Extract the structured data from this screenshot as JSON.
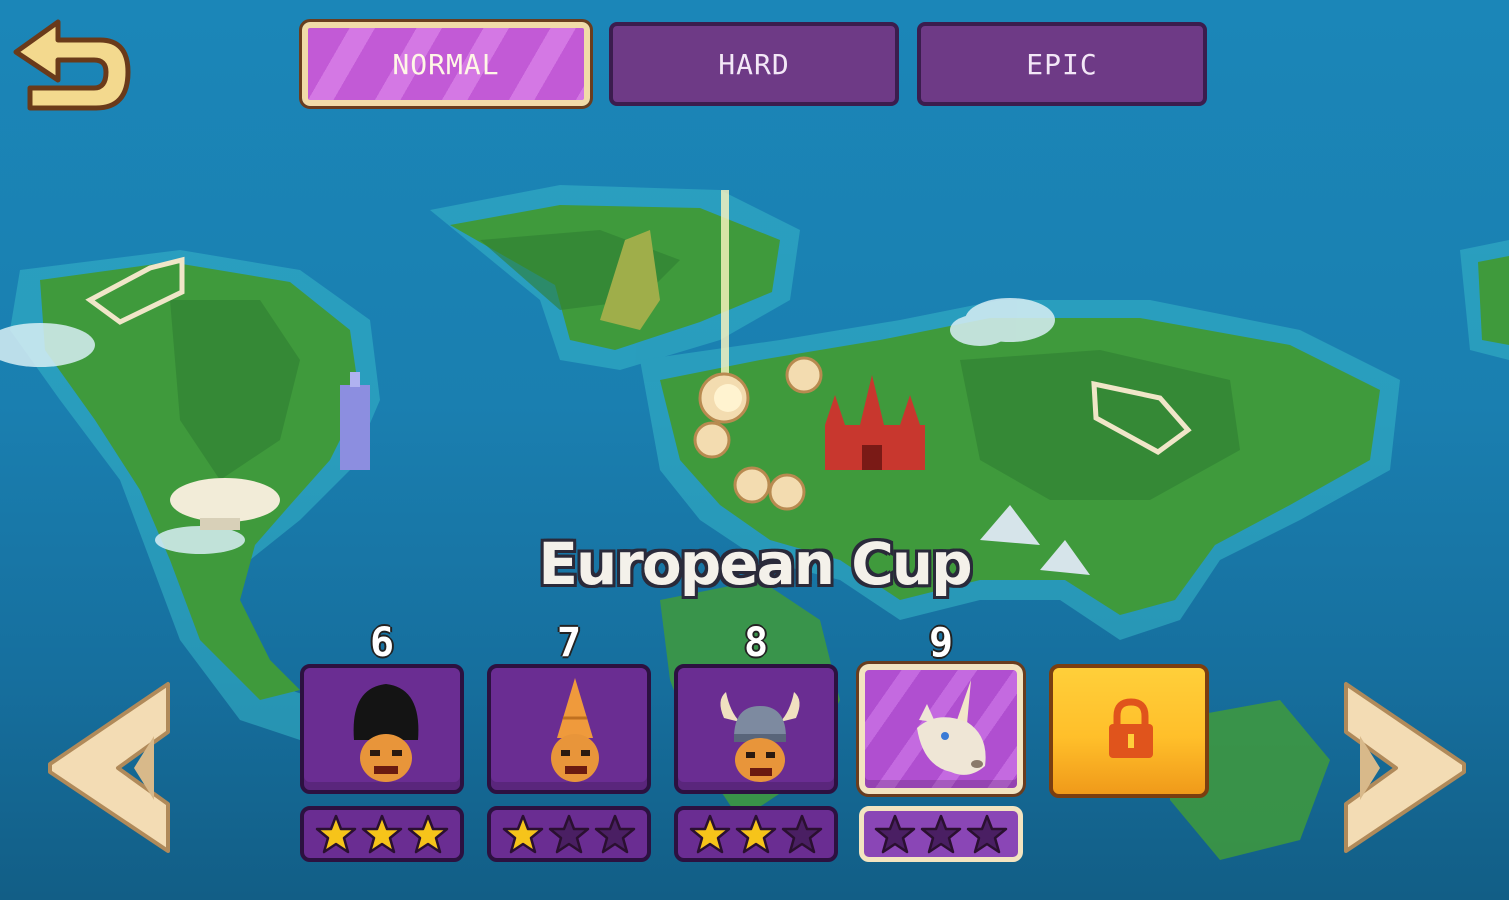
{
  "header": {
    "back_icon": "back-arrow-icon",
    "tabs": [
      {
        "label": "NORMAL",
        "active": true
      },
      {
        "label": "HARD",
        "active": false
      },
      {
        "label": "EPIC",
        "active": false
      }
    ]
  },
  "cup": {
    "title": "European Cup"
  },
  "levels": [
    {
      "number": "6",
      "stars_earned": 3,
      "stars_total": 3,
      "avatar": "royal-guard-head-icon",
      "current": false
    },
    {
      "number": "7",
      "stars_earned": 1,
      "stars_total": 3,
      "avatar": "cone-hat-head-icon",
      "current": false
    },
    {
      "number": "8",
      "stars_earned": 2,
      "stars_total": 3,
      "avatar": "viking-helmet-head-icon",
      "current": false
    },
    {
      "number": "9",
      "stars_earned": 0,
      "stars_total": 3,
      "avatar": "unicorn-head-icon",
      "current": true
    }
  ],
  "locked_level": {
    "icon": "padlock-icon"
  },
  "navigation": {
    "prev_icon": "chevron-left-icon",
    "next_icon": "chevron-right-icon"
  },
  "colors": {
    "ocean": "#1b86b8",
    "land": "#3f9a3c",
    "tab_purple": "#6e3a86",
    "tab_active": "#c25ad6",
    "frame_cream": "#f1dba8",
    "star_gold": "#f6c41a",
    "star_empty": "#4a1f63",
    "lock_gold": "#ffc22e"
  }
}
